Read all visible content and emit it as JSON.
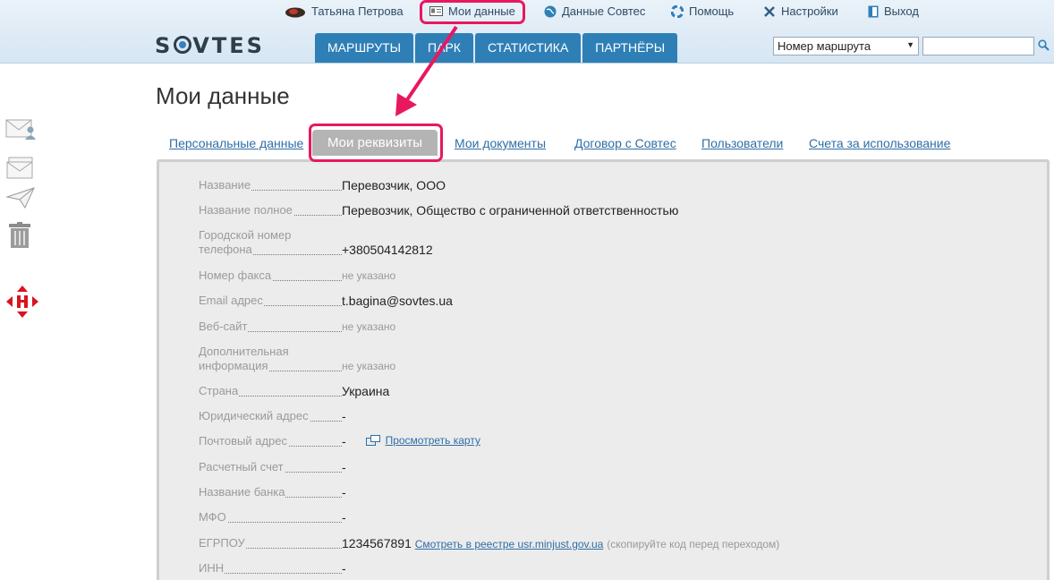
{
  "top_menu": {
    "user_name": "Татьяна Петрова",
    "my_data": "Мои данные",
    "sovtes_data": "Данные Совтес",
    "help": "Помощь",
    "settings": "Настройки",
    "logout": "Выход"
  },
  "logo": {
    "text_before": "S",
    "text_after": "VTES"
  },
  "main_tabs": [
    "МАРШРУТЫ",
    "ПАРК",
    "СТАТИСТИКА",
    "ПАРТНЁРЫ"
  ],
  "search": {
    "select_value": "Номер маршрута",
    "input_value": ""
  },
  "page_title": "Мои данные",
  "sub_tabs": [
    "Персональные данные",
    "Мои реквизиты",
    "Мои документы",
    "Договор с Совтес",
    "Пользователи",
    "Счета за использование"
  ],
  "active_sub_tab": "Мои реквизиты",
  "fields": [
    {
      "label": "Название",
      "value": "Перевозчик, ООО"
    },
    {
      "label": "Название полное",
      "value": "Перевозчик, Общество с ограниченной ответственностью"
    },
    {
      "label": "Городской номер телефона",
      "value": "+380504142812"
    },
    {
      "label": "Номер факса",
      "value": "не указано"
    },
    {
      "label": "Email адрес",
      "value": "t.bagina@sovtes.ua"
    },
    {
      "label": "Веб-сайт",
      "value": "не указано"
    },
    {
      "label": "Дополнительная информация",
      "value": "не указано"
    },
    {
      "label": "Страна",
      "value": "Украина"
    },
    {
      "label": "Юридический адрес",
      "value": "-"
    },
    {
      "label": "Почтовый адрес",
      "value": "-",
      "link": "Просмотреть карту"
    },
    {
      "label": "Расчетный счет",
      "value": "-"
    },
    {
      "label": "Название банка",
      "value": "-"
    },
    {
      "label": "МФО",
      "value": "-"
    },
    {
      "label": "ЕГРПОУ",
      "value": "1234567891",
      "link": "Смотреть в реестре usr.minjust.gov.ua",
      "note": "(скопируйте код перед переходом)"
    },
    {
      "label": "ИНН",
      "value": "-"
    }
  ],
  "colors": {
    "accent": "#2f7fb7",
    "highlight": "#e8185f",
    "active_tab": "#b4b4b4"
  }
}
